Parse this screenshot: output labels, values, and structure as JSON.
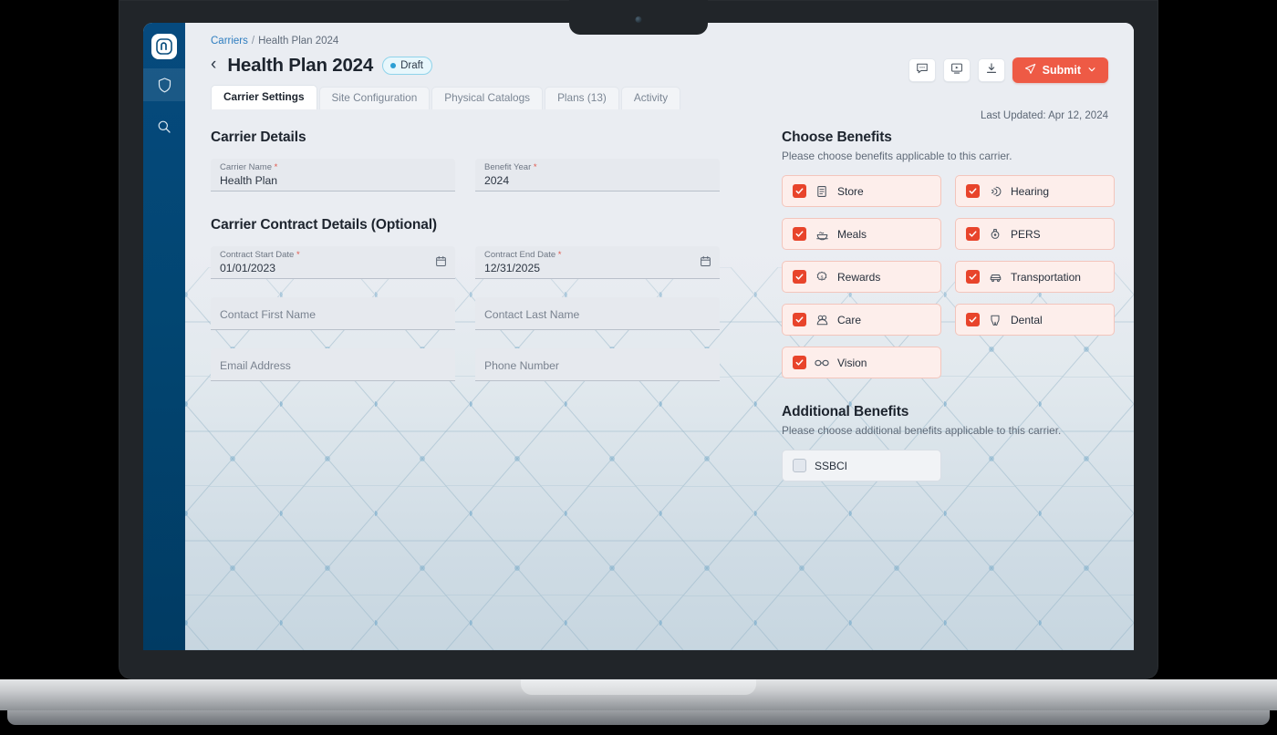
{
  "sidebar": {
    "logo_label": "n",
    "items": [
      {
        "name": "shield-icon",
        "label": "Shield",
        "active": true
      },
      {
        "name": "search-icon",
        "label": "Search",
        "active": false
      }
    ]
  },
  "header": {
    "breadcrumb": {
      "parent": "Carriers",
      "separator": "/",
      "current": "Health Plan 2024"
    },
    "back_label": "‹",
    "title": "Health Plan 2024",
    "status": "Draft",
    "actions": [
      {
        "name": "comment-icon",
        "label": "Comments"
      },
      {
        "name": "video-icon",
        "label": "Video"
      },
      {
        "name": "download-icon",
        "label": "Download"
      }
    ],
    "submit_label": "Submit",
    "last_updated": "Last Updated: Apr 12, 2024"
  },
  "tabs": [
    {
      "label": "Carrier Settings",
      "active": true
    },
    {
      "label": "Site Configuration",
      "active": false
    },
    {
      "label": "Physical Catalogs",
      "active": false
    },
    {
      "label": "Plans (13)",
      "active": false
    },
    {
      "label": "Activity",
      "active": false
    }
  ],
  "carrier_details": {
    "title": "Carrier Details",
    "fields": [
      {
        "label": "Carrier Name",
        "required": true,
        "value": "Health Plan",
        "placeholder": ""
      },
      {
        "label": "Benefit Year",
        "required": true,
        "value": "2024",
        "placeholder": ""
      }
    ]
  },
  "contract_details": {
    "title": "Carrier Contract Details (Optional)",
    "fields": [
      {
        "label": "Contract Start Date",
        "required": true,
        "value": "01/01/2023",
        "placeholder": "",
        "icon": "calendar-icon"
      },
      {
        "label": "Contract End Date",
        "required": true,
        "value": "12/31/2025",
        "placeholder": "",
        "icon": "calendar-icon"
      },
      {
        "label": "",
        "required": false,
        "value": "",
        "placeholder": "Contact First Name"
      },
      {
        "label": "",
        "required": false,
        "value": "",
        "placeholder": "Contact Last Name"
      },
      {
        "label": "",
        "required": false,
        "value": "",
        "placeholder": "Email Address"
      },
      {
        "label": "",
        "required": false,
        "value": "",
        "placeholder": "Phone Number"
      }
    ]
  },
  "choose_benefits": {
    "title": "Choose Benefits",
    "subtitle": "Please choose benefits applicable to this carrier.",
    "items": [
      {
        "label": "Store",
        "icon": "document-icon",
        "checked": true
      },
      {
        "label": "Hearing",
        "icon": "hearing-icon",
        "checked": true
      },
      {
        "label": "Meals",
        "icon": "meals-icon",
        "checked": true
      },
      {
        "label": "PERS",
        "icon": "pers-icon",
        "checked": true
      },
      {
        "label": "Rewards",
        "icon": "rewards-badge-icon",
        "checked": true
      },
      {
        "label": "Transportation",
        "icon": "car-icon",
        "checked": true
      },
      {
        "label": "Care",
        "icon": "care-icon",
        "checked": true
      },
      {
        "label": "Dental",
        "icon": "tooth-icon",
        "checked": true
      },
      {
        "label": "Vision",
        "icon": "glasses-icon",
        "checked": true
      }
    ]
  },
  "additional_benefits": {
    "title": "Additional Benefits",
    "subtitle": "Please choose additional benefits applicable to this carrier.",
    "items": [
      {
        "label": "SSBCI",
        "icon": "",
        "checked": false
      }
    ]
  },
  "colors": {
    "accent_red": "#ee5a45",
    "checkbox_red": "#e8442b",
    "benefit_bg": "#fdeeeb",
    "benefit_border": "#f3c5bc",
    "sidebar_blue": "#024672",
    "link_blue": "#2f7ec0",
    "badge_blue": "#2b9fd4"
  }
}
